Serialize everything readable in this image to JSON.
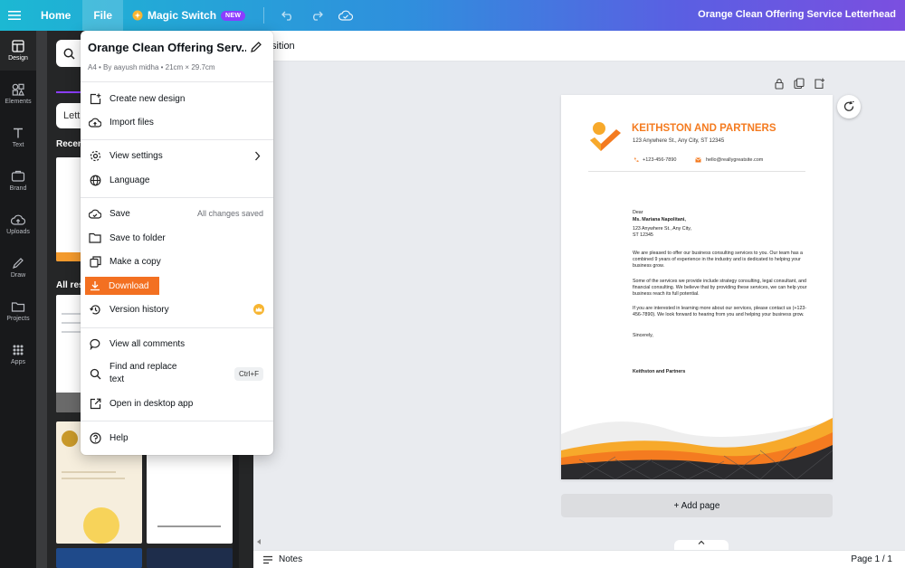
{
  "topbar": {
    "home": "Home",
    "file": "File",
    "magic_switch": "Magic Switch",
    "new_badge": "NEW",
    "doc_title": "Orange Clean Offering Service Letterhead"
  },
  "rail": {
    "items": [
      {
        "label": "Design",
        "icon": "design-icon"
      },
      {
        "label": "Elements",
        "icon": "elements-icon"
      },
      {
        "label": "Text",
        "icon": "text-icon"
      },
      {
        "label": "Brand",
        "icon": "brand-icon"
      },
      {
        "label": "Uploads",
        "icon": "uploads-icon"
      },
      {
        "label": "Draw",
        "icon": "draw-icon"
      },
      {
        "label": "Projects",
        "icon": "projects-icon"
      },
      {
        "label": "Apps",
        "icon": "apps-icon"
      }
    ]
  },
  "panel": {
    "chip": "Lett",
    "recent": "Recen",
    "all_results": "All res"
  },
  "editor": {
    "position_label": "sition",
    "add_page": "+ Add page",
    "notes": "Notes",
    "page_count": "Page 1 / 1"
  },
  "letterhead": {
    "company": "KEITHSTON AND PARTNERS",
    "address": "123 Anywhere St., Any City, ST 12345",
    "phone": "+123-456-7890",
    "email": "hello@reallygreatsite.com",
    "dear": "Dear",
    "recipient": "Ms. Mariana Napolitani,",
    "recipient_addr1": "123 Anywhere St., Any City,",
    "recipient_addr2": "ST 12345",
    "para1": "We are pleased to offer our business consulting services to you. Our team has a combined 9 years of experience in the industry and is dedicated to helping your business grow.",
    "para2": "Some of the services we provide include strategy consulting, legal consultant, and financial consulting. We believe that by providing these services, we can help your business reach its full potential.",
    "para3": "If you are interested in learning more about our services, please contact us (+123-456-7890). We look forward to hearing from you and helping your business grow.",
    "closing": "Sincerely,",
    "signature": "Keithston and Partners"
  },
  "file_menu": {
    "title": "Orange Clean Offering Serv...",
    "meta": "A4 • By aayush midha • 21cm × 29.7cm",
    "items": {
      "create_new": "Create new design",
      "import_files": "Import files",
      "view_settings": "View settings",
      "language": "Language",
      "save": "Save",
      "save_status": "All changes saved",
      "save_to_folder": "Save to folder",
      "make_copy": "Make a copy",
      "download": "Download",
      "version_history": "Version history",
      "view_comments": "View all comments",
      "find_replace_1": "Find and replace",
      "find_replace_2": "text",
      "find_replace_kbd": "Ctrl+F",
      "open_desktop": "Open in desktop app",
      "help": "Help"
    }
  },
  "colors": {
    "accent_orange": "#f47b20",
    "download_highlight": "#f37021",
    "rail_bg": "#18191b",
    "panel_bg": "#252627"
  }
}
